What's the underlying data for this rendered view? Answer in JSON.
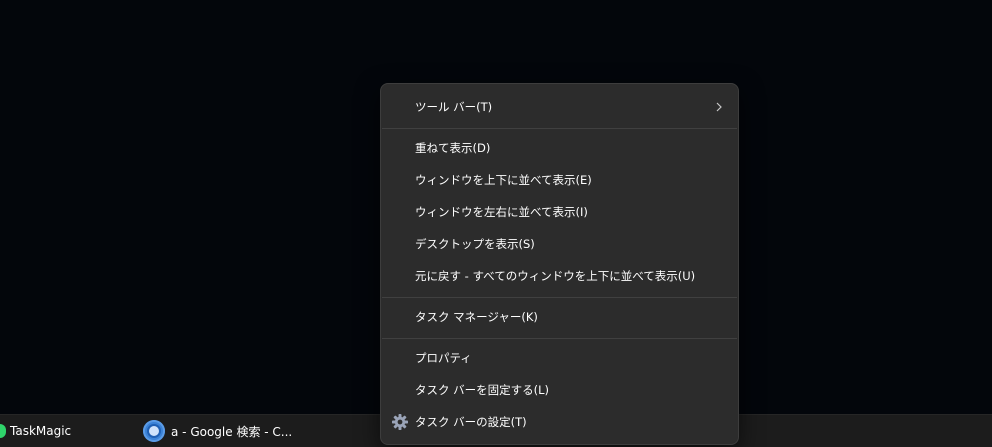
{
  "taskbar": {
    "apps": [
      {
        "label": "TaskMagic",
        "icon": "taskmagic-icon"
      },
      {
        "label": "a - Google 検索 - C...",
        "icon": "chrome-icon"
      }
    ]
  },
  "context_menu": {
    "items": [
      {
        "label": "ツール バー(T)",
        "has_submenu": true
      },
      {
        "label": "重ねて表示(D)"
      },
      {
        "label": "ウィンドウを上下に並べて表示(E)"
      },
      {
        "label": "ウィンドウを左右に並べて表示(I)"
      },
      {
        "label": "デスクトップを表示(S)"
      },
      {
        "label": "元に戻す - すべてのウィンドウを上下に並べて表示(U)"
      },
      {
        "label": "タスク マネージャー(K)"
      },
      {
        "label": "プロパティ"
      },
      {
        "label": "タスク バーを固定する(L)"
      },
      {
        "label": "タスク バーの設定(T)",
        "icon": "gear-icon"
      }
    ]
  },
  "colors": {
    "desktop_bg": "#03060b",
    "menu_bg": "#2c2c2c",
    "taskbar_bg": "#1c1c1c",
    "text": "#ffffff"
  }
}
